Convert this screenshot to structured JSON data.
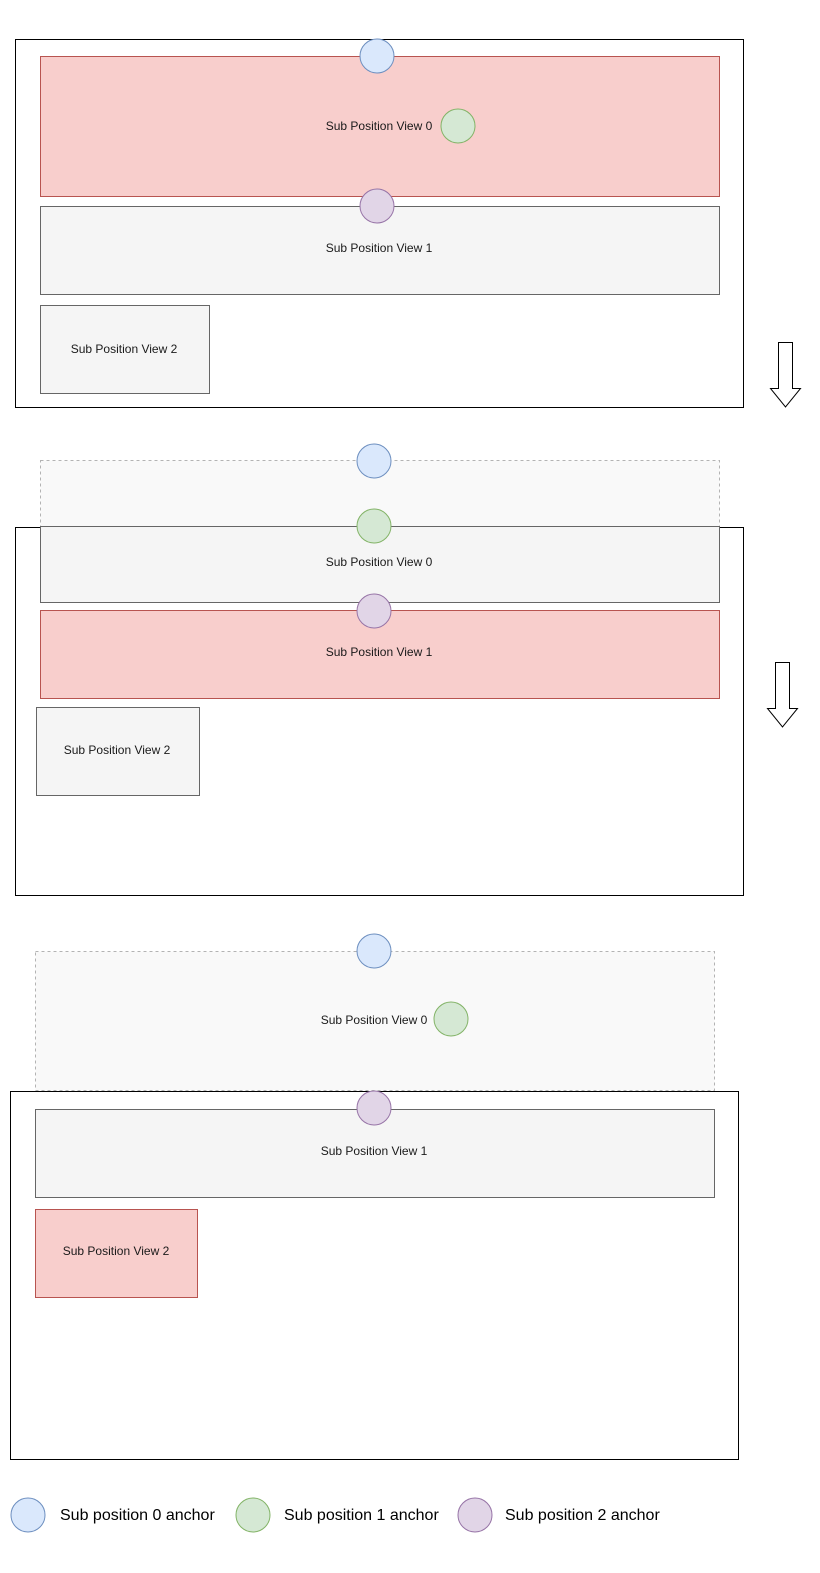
{
  "colors": {
    "highlight_fill": "#f8cecc",
    "highlight_stroke": "#b85450",
    "view_fill": "#f5f5f5",
    "view_stroke": "#666666",
    "ghost_fill": "#f9f9f9",
    "ghost_stroke": "#b3b3b3",
    "anchor0_fill": "#dae8fc",
    "anchor0_stroke": "#6c8ebf",
    "anchor1_fill": "#d5e8d4",
    "anchor1_stroke": "#82b366",
    "anchor2_fill": "#e1d5e7",
    "anchor2_stroke": "#9673a6"
  },
  "panels": [
    {
      "views": [
        "Sub Position View 0",
        "Sub Position View 1",
        "Sub Position View 2"
      ],
      "highlighted": 0
    },
    {
      "views": [
        "Sub Position View 0",
        "Sub Position View 1",
        "Sub Position View 2"
      ],
      "highlighted": 1
    },
    {
      "views": [
        "Sub Position View 0",
        "Sub Position View 1",
        "Sub Position View 2"
      ],
      "highlighted": 2
    }
  ],
  "arrows": [
    "arrow-down-icon",
    "arrow-down-icon"
  ],
  "legend": [
    {
      "label": "Sub position 0 anchor"
    },
    {
      "label": "Sub position 1 anchor"
    },
    {
      "label": "Sub position 2 anchor"
    }
  ]
}
